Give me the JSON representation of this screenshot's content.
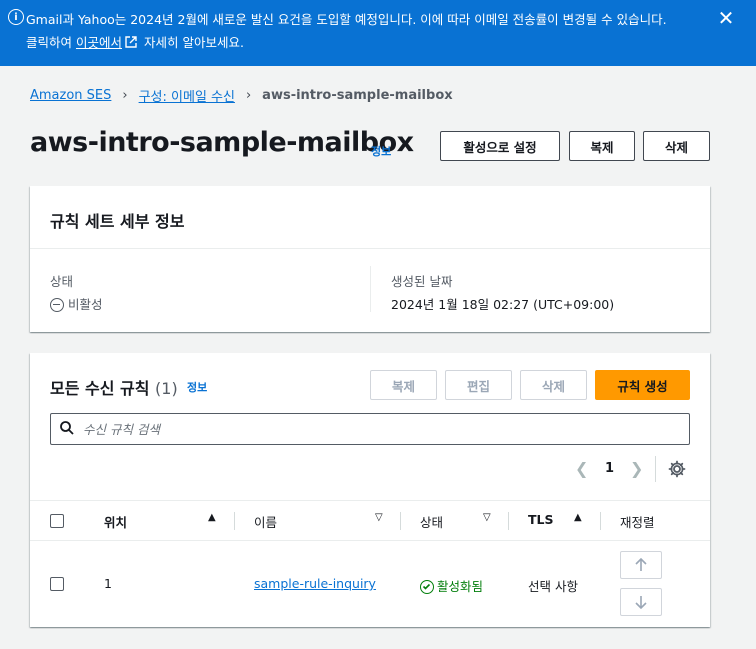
{
  "banner": {
    "line1": "Gmail과 Yahoo는 2024년 2월에 새로운 발신 요건을 도입할 예정입니다. 이에 따라 이메일 전송률이 변경될 수 있습니다.",
    "line2_prefix": "클릭하여 ",
    "link_text": "이곳에서",
    "line2_suffix": " 자세히 알아보세요.",
    "close_label": "✕",
    "color": "#0972d3"
  },
  "breadcrumb": {
    "items": [
      "Amazon SES",
      "구성: 이메일 수신"
    ],
    "current": "aws-intro-sample-mailbox",
    "separator": "›"
  },
  "header": {
    "title": "aws-intro-sample-mailbox",
    "info": "정보",
    "buttons": {
      "set_active": "활성으로 설정",
      "copy": "복제",
      "delete": "삭제"
    }
  },
  "details": {
    "title": "규칙 세트 세부 정보",
    "status_label": "상태",
    "status_value": "비활성",
    "created_label": "생성된 날짜",
    "created_value": "2024년 1월 18일 02:27 (UTC+09:00)"
  },
  "rules": {
    "title": "모든 수신 규칙",
    "count": "(1)",
    "info": "정보",
    "buttons": {
      "copy": "복제",
      "edit": "편집",
      "delete": "삭제",
      "create": "규칙 생성"
    },
    "search_placeholder": "수신 규칙 검색",
    "page": "1",
    "columns": {
      "position": "위치",
      "name": "이름",
      "status": "상태",
      "tls": "TLS",
      "reorder": "재정렬"
    },
    "rows": [
      {
        "position": "1",
        "name": "sample-rule-inquiry",
        "status": "활성화됨",
        "tls": "선택 사항"
      }
    ],
    "accent_color": "#ff9900",
    "active_color": "#037f0c",
    "link_color": "#0972d3"
  }
}
